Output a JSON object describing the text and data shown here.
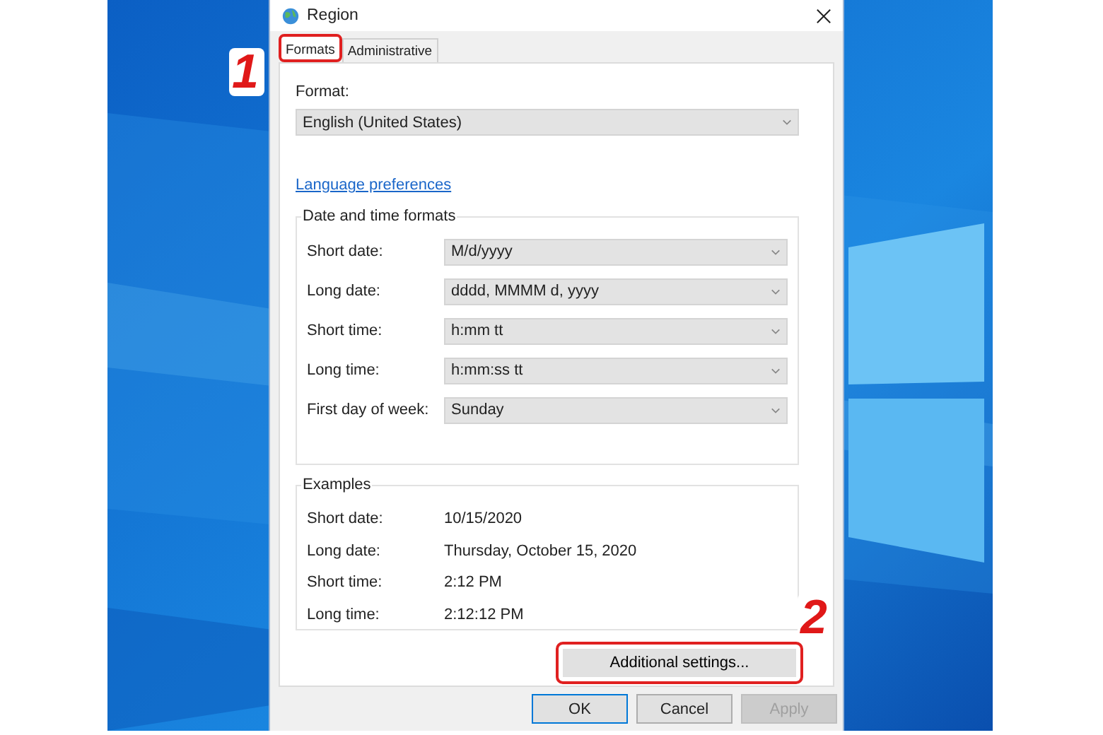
{
  "window": {
    "title": "Region"
  },
  "tabs": [
    {
      "label": "Formats",
      "selected": true,
      "highlighted": true
    },
    {
      "label": "Administrative",
      "selected": false,
      "highlighted": false
    }
  ],
  "format": {
    "label": "Format:",
    "value": "English (United States)"
  },
  "language_link": "Language preferences",
  "date_time_formats": {
    "title": "Date and time formats",
    "rows": [
      {
        "label": "Short date:",
        "value": "M/d/yyyy"
      },
      {
        "label": "Long date:",
        "value": "dddd, MMMM d, yyyy"
      },
      {
        "label": "Short time:",
        "value": "h:mm tt"
      },
      {
        "label": "Long time:",
        "value": "h:mm:ss tt"
      },
      {
        "label": "First day of week:",
        "value": "Sunday"
      }
    ]
  },
  "examples": {
    "title": "Examples",
    "rows": [
      {
        "label": "Short date:",
        "value": "10/15/2020"
      },
      {
        "label": "Long date:",
        "value": "Thursday, October 15, 2020"
      },
      {
        "label": "Short time:",
        "value": "2:12 PM"
      },
      {
        "label": "Long time:",
        "value": "2:12:12 PM"
      }
    ]
  },
  "additional_settings": {
    "label": "Additional settings...",
    "highlighted": true
  },
  "buttons": [
    {
      "label": "OK",
      "default": true,
      "disabled": false
    },
    {
      "label": "Cancel",
      "default": false,
      "disabled": false
    },
    {
      "label": "Apply",
      "default": false,
      "disabled": true
    }
  ],
  "annotations": [
    {
      "label": "1"
    },
    {
      "label": "2"
    }
  ]
}
